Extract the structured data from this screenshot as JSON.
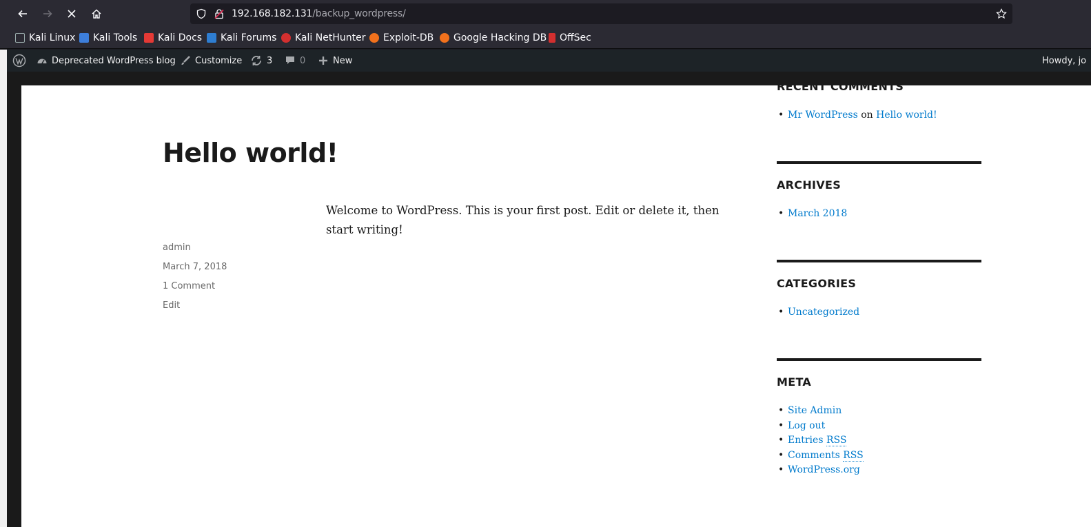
{
  "browser": {
    "url_host": "192.168.182.131",
    "url_path": "/backup_wordpress/"
  },
  "bookmarks": [
    {
      "label": "Kali Linux",
      "icon": "kali-dragon-icon",
      "color": "#2b8fd6"
    },
    {
      "label": "Kali Tools",
      "icon": "kali-tools-icon",
      "color": "#3d7edb"
    },
    {
      "label": "Kali Docs",
      "icon": "kali-docs-icon",
      "color": "#e53935"
    },
    {
      "label": "Kali Forums",
      "icon": "kali-forums-icon",
      "color": "#2e7dd1"
    },
    {
      "label": "Kali NetHunter",
      "icon": "nethunter-icon",
      "color": "#d32f2f"
    },
    {
      "label": "Exploit-DB",
      "icon": "exploitdb-icon",
      "color": "#f2711c"
    },
    {
      "label": "Google Hacking DB",
      "icon": "ghdb-icon",
      "color": "#f2711c"
    },
    {
      "label": "OffSec",
      "icon": "offsec-icon",
      "color": "#d32f2f"
    }
  ],
  "adminbar": {
    "site_name": "Deprecated WordPress blog",
    "customize": "Customize",
    "updates": "3",
    "comments": "0",
    "new": "New",
    "howdy": "Howdy, jo"
  },
  "post": {
    "title": "Hello world!",
    "body": "Welcome to WordPress. This is your first post. Edit or delete it, then start writing!",
    "author": "admin",
    "date": "March 7, 2018",
    "comments": "1 Comment",
    "edit": "Edit"
  },
  "sidebar": {
    "recent_comments_title": "RECENT COMMENTS",
    "recent_comment_author": "Mr WordPress",
    "recent_comment_on": "on",
    "recent_comment_post": "Hello world!",
    "archives_title": "ARCHIVES",
    "archives": [
      "March 2018"
    ],
    "categories_title": "CATEGORIES",
    "categories": [
      "Uncategorized"
    ],
    "meta_title": "META",
    "meta": {
      "site_admin": "Site Admin",
      "log_out": "Log out",
      "entries": "Entries",
      "comments": "Comments",
      "rss": "RSS",
      "wordpress_org": "WordPress.org"
    }
  }
}
